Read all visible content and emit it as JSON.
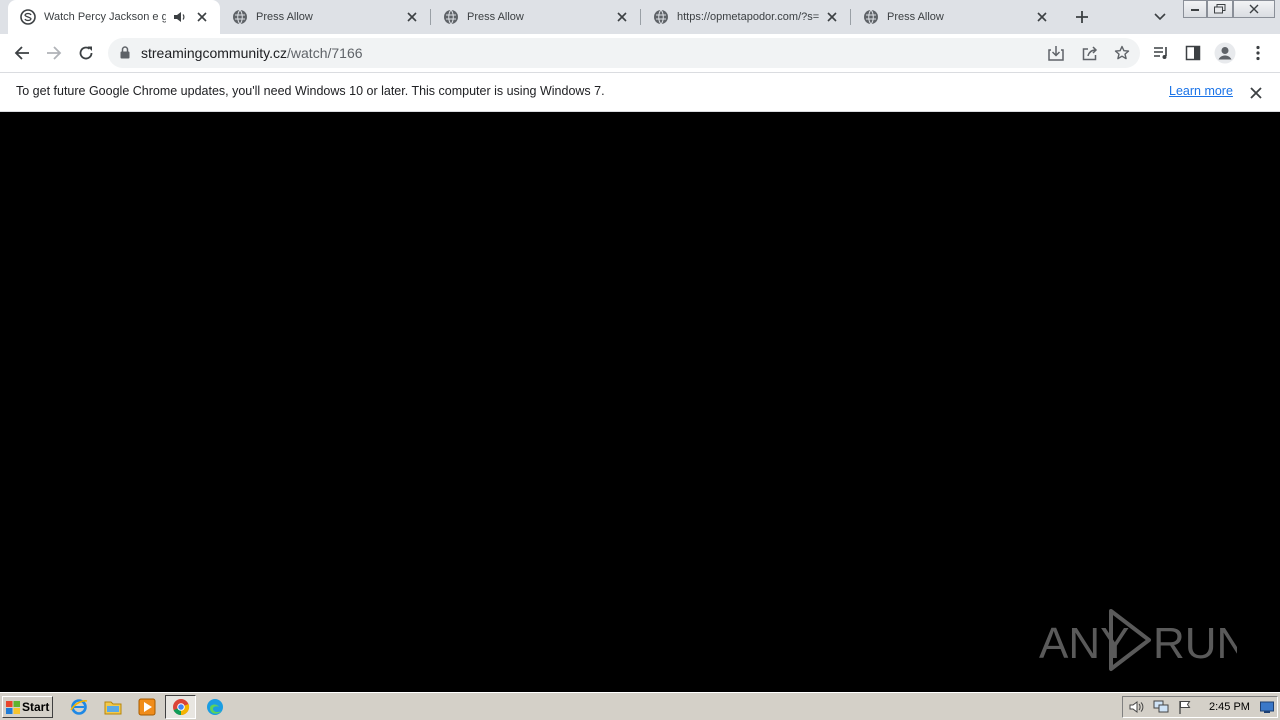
{
  "browser": {
    "tabs": [
      {
        "title": "Watch Percy Jackson e gli",
        "favicon": "streamingcommunity-logo-icon",
        "active": true,
        "audio": true
      },
      {
        "title": "Press Allow",
        "favicon": "globe-icon",
        "active": false
      },
      {
        "title": "Press Allow",
        "favicon": "globe-icon",
        "active": false
      },
      {
        "title": "https://opmetapodor.com/?s=",
        "favicon": "globe-icon",
        "active": false
      },
      {
        "title": "Press Allow",
        "favicon": "globe-icon",
        "active": false
      }
    ],
    "address": {
      "domain": "streamingcommunity.cz",
      "path": "/watch/7166"
    }
  },
  "infobar": {
    "message": "To get future Google Chrome updates, you'll need Windows 10 or later. This computer is using Windows 7.",
    "link": "Learn more"
  },
  "watermark": {
    "left": "ANY",
    "right": "RUN"
  },
  "taskbar": {
    "start_label": "Start",
    "clock": "2:45 PM"
  },
  "colors": {
    "tabstrip": "#dee1e6",
    "link": "#1a73e8",
    "content": "#000000",
    "taskbar": "#d4d0c8"
  }
}
